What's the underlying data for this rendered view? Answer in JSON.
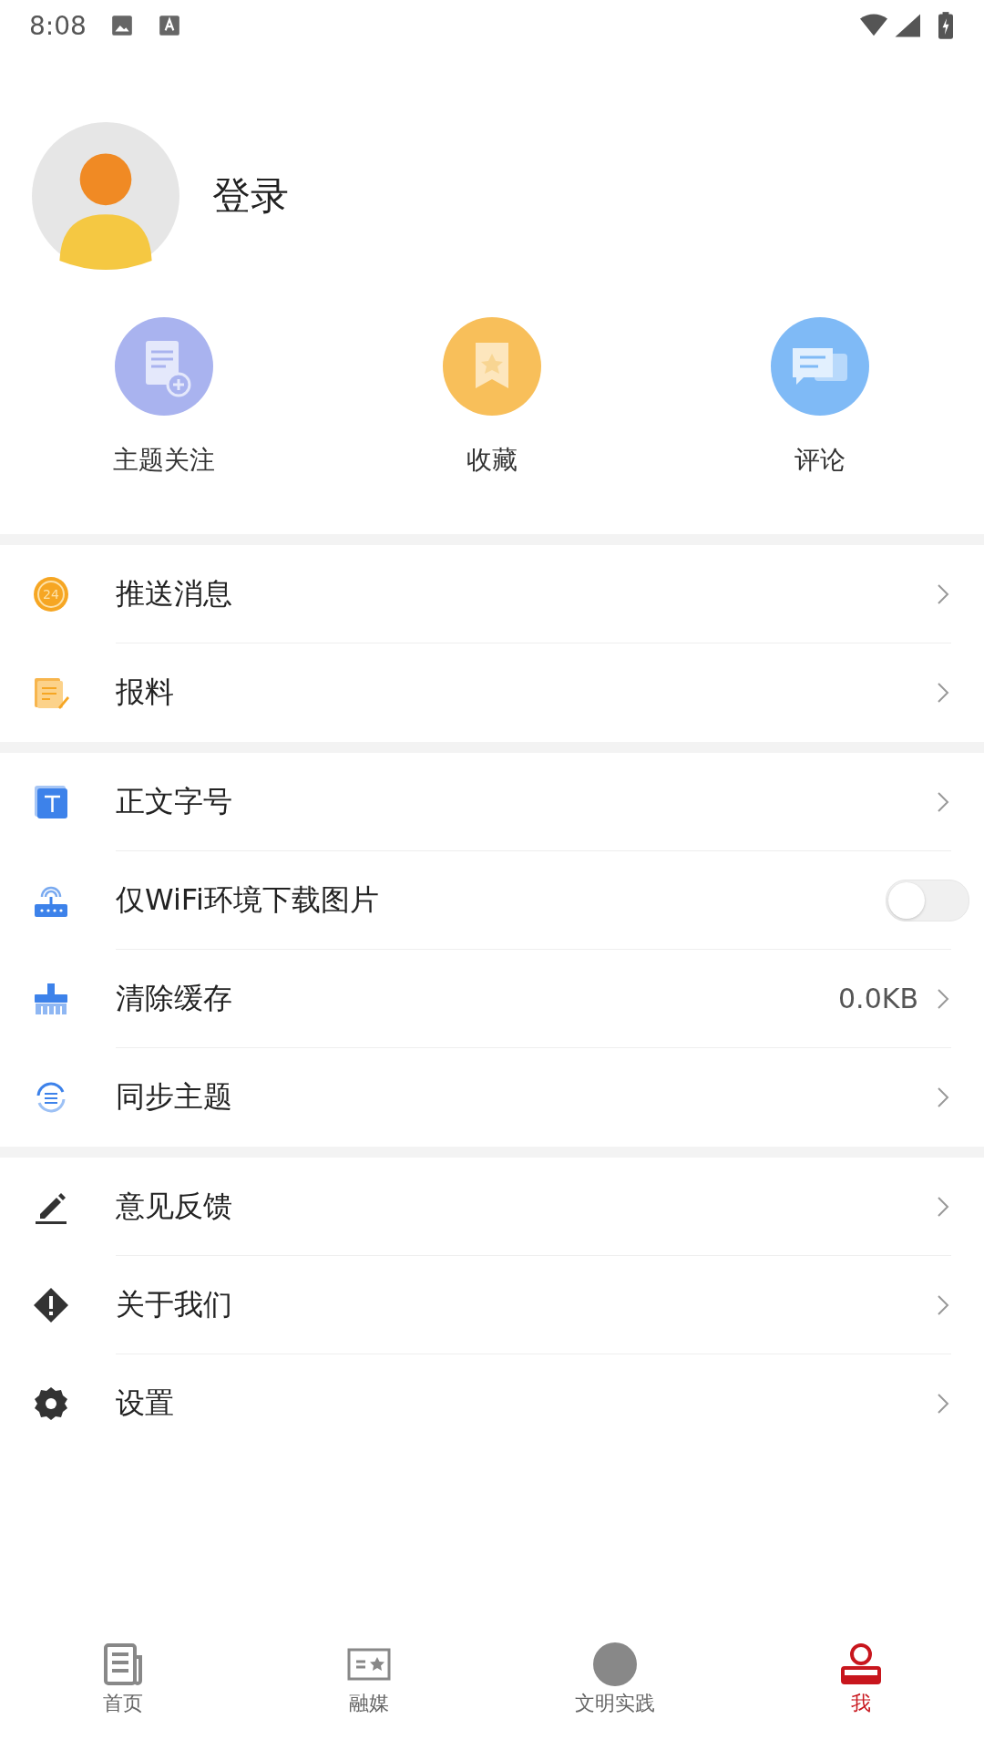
{
  "status_bar": {
    "time": "8:08"
  },
  "profile": {
    "login": "登录"
  },
  "shortcuts": [
    {
      "kind": "subscribe",
      "label": "主题关注"
    },
    {
      "kind": "bookmark",
      "label": "收藏"
    },
    {
      "kind": "comment",
      "label": "评论"
    }
  ],
  "groups": [
    {
      "items": [
        {
          "kind": "clock",
          "icon_text": "24",
          "label": "推送消息"
        },
        {
          "kind": "note",
          "label": "报料"
        }
      ]
    },
    {
      "items": [
        {
          "kind": "font",
          "label": "正文字号"
        },
        {
          "kind": "router",
          "label": "仅WiFi环境下载图片",
          "toggle": {
            "on": false
          }
        },
        {
          "kind": "brush",
          "label": "清除缓存",
          "value": "0.0KB"
        },
        {
          "kind": "sync",
          "label": "同步主题"
        }
      ]
    },
    {
      "items": [
        {
          "kind": "pen",
          "label": "意见反馈"
        },
        {
          "kind": "info",
          "label": "关于我们"
        },
        {
          "kind": "gear",
          "label": "设置"
        }
      ]
    }
  ],
  "tabs": [
    {
      "kind": "news",
      "label": "首页",
      "selected": false
    },
    {
      "kind": "media",
      "label": "融媒",
      "selected": false
    },
    {
      "kind": "dot",
      "label": "文明实践",
      "selected": false
    },
    {
      "kind": "person",
      "label": "我",
      "selected": true
    }
  ]
}
